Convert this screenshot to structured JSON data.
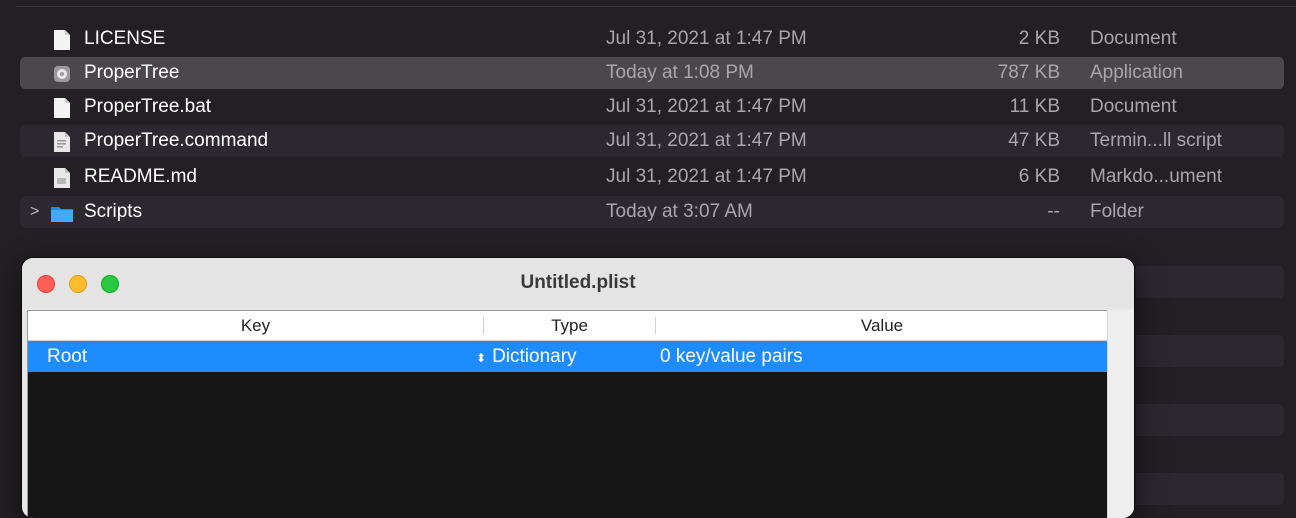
{
  "finder": {
    "rows": [
      {
        "name": "LICENSE",
        "date": "Jul 31, 2021 at 1:47 PM",
        "size": "2 KB",
        "kind": "Document",
        "icon": "document-icon"
      },
      {
        "name": "ProperTree",
        "date": "Today at 1:08 PM",
        "size": "787 KB",
        "kind": "Application",
        "icon": "app-icon"
      },
      {
        "name": "ProperTree.bat",
        "date": "Jul 31, 2021 at 1:47 PM",
        "size": "11 KB",
        "kind": "Document",
        "icon": "document-icon"
      },
      {
        "name": "ProperTree.command",
        "date": "Jul 31, 2021 at 1:47 PM",
        "size": "47 KB",
        "kind": "Termin...ll script",
        "icon": "script-icon"
      },
      {
        "name": "README.md",
        "date": "Jul 31, 2021 at 1:47 PM",
        "size": "6 KB",
        "kind": "Markdo...ument",
        "icon": "text-document-icon"
      },
      {
        "name": "Scripts",
        "date": "Today at 3:07 AM",
        "size": "--",
        "kind": "Folder",
        "icon": "folder-icon",
        "disclosure": ">"
      }
    ]
  },
  "plist_window": {
    "title": "Untitled.plist",
    "columns": {
      "key": "Key",
      "type": "Type",
      "value": "Value"
    },
    "selected_row": {
      "key": "Root",
      "type": "Dictionary",
      "type_arrow": "⬍",
      "value": "0 key/value pairs"
    }
  },
  "colors": {
    "background": "#231f24",
    "selection_blue": "#1c8cff",
    "traffic_close": "#ff5f57",
    "traffic_minimize": "#febc2e",
    "traffic_zoom": "#28c840"
  }
}
